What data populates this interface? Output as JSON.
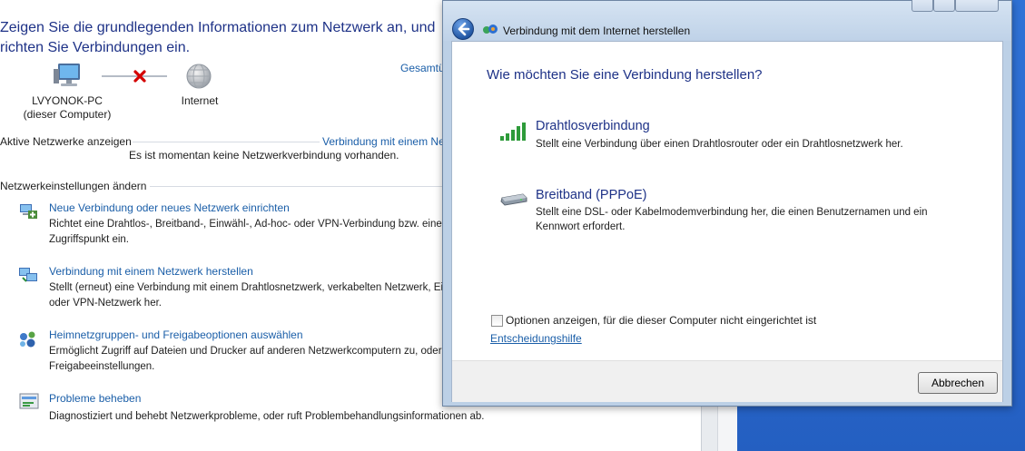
{
  "panel": {
    "heading": "Zeigen Sie die grundlegenden Informationen zum Netzwerk an, und richten Sie Verbindungen ein.",
    "map": {
      "computer_name": "LVYONOK-PC",
      "computer_sub": "(dieser Computer)",
      "internet_label": "Internet",
      "full_map_link": "Gesamtübersicht anzeigen"
    },
    "active_section": "Aktive Netzwerke anzeigen",
    "connect_link": "Verbindung mit einem Netzwerk herstellen",
    "no_connection": "Es ist momentan keine Netzwerkverbindung vorhanden.",
    "settings_section": "Netzwerkeinstellungen ändern",
    "tasks": [
      {
        "title": "Neue Verbindung oder neues Netzwerk einrichten",
        "desc1": "Richtet eine Drahtlos-, Breitband-, Einwähl-, Ad-hoc- oder VPN-Verbindung bzw. einen Router oder",
        "desc2": "Zugriffspunkt ein.",
        "icon": "new-connection-icon"
      },
      {
        "title": "Verbindung mit einem Netzwerk herstellen",
        "desc1": "Stellt (erneut) eine Verbindung mit einem Drahtlosnetzwerk, verkabelten Netzwerk, Einwähl-",
        "desc2": "oder VPN-Netzwerk her.",
        "icon": "connect-network-icon"
      },
      {
        "title": "Heimnetzgruppen- und Freigabeoptionen auswählen",
        "desc1": "Ermöglicht Zugriff auf Dateien und Drucker auf anderen Netzwerkcomputern zu, oder ändern Sie die",
        "desc2": "Freigabeeinstellungen.",
        "icon": "homegroup-icon"
      },
      {
        "title": "Probleme beheben",
        "desc1": "Diagnostiziert und behebt Netzwerkprobleme, oder ruft Problembehandlungsinformationen ab.",
        "desc2": "",
        "icon": "troubleshoot-icon"
      }
    ]
  },
  "dialog": {
    "title": "Verbindung mit dem Internet herstellen",
    "question": "Wie möchten Sie eine Verbindung herstellen?",
    "options": [
      {
        "title": "Drahtlosverbindung",
        "desc": "Stellt eine Verbindung über einen Drahtlosrouter oder ein Drahtlosnetzwerk her.",
        "icon": "wireless-signal-icon"
      },
      {
        "title": "Breitband (PPPoE)",
        "desc": "Stellt eine DSL- oder Kabelmodemverbindung her, die einen Benutzernamen und ein Kennwort erfordert.",
        "icon": "broadband-modem-icon"
      }
    ],
    "checkbox_label": "Optionen anzeigen, für die dieser Computer nicht eingerichtet ist",
    "checkbox_checked": false,
    "help_link": "Entscheidungshilfe",
    "cancel_label": "Abbrechen"
  },
  "colors": {
    "heading": "#1e3287",
    "link": "#1a5ea8",
    "desktop": "#2b6ad0",
    "error_x": "#d40000"
  }
}
